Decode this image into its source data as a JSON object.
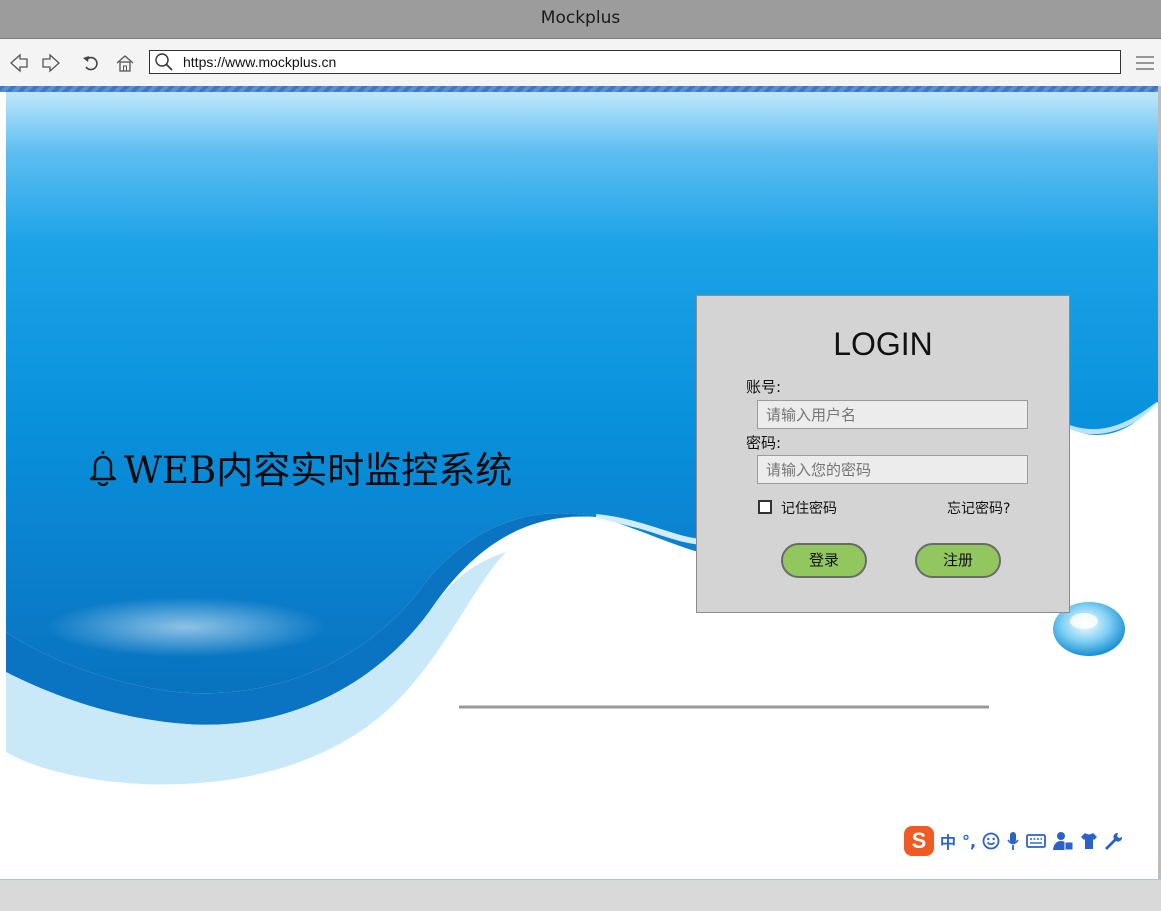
{
  "window": {
    "title": "Mockplus"
  },
  "browser": {
    "url": "https://www.mockplus.cn",
    "icons": [
      "back-icon",
      "forward-icon",
      "refresh-icon",
      "home-icon",
      "search-icon",
      "menu-icon"
    ]
  },
  "hero": {
    "heading": "WEB内容实时监控系统",
    "icon": "bell-icon"
  },
  "login": {
    "title": "LOGIN",
    "username_label": "账号:",
    "username_placeholder": "请输入用户名",
    "password_label": "密码:",
    "password_placeholder": "请输入您的密码",
    "remember_label": "记住密码",
    "remember_checked": false,
    "forgot_label": "忘记密码?",
    "login_button": "登录",
    "register_button": "注册"
  },
  "ime_toolbar": {
    "logo": "S",
    "mode": "中",
    "punct": "°,",
    "icons": [
      "emoji-icon",
      "microphone-icon",
      "keyboard-icon",
      "user-tools-icon",
      "skin-icon",
      "wrench-icon"
    ]
  },
  "colors": {
    "button_green": "#92c760",
    "panel_gray": "#d4d4d4",
    "sky_blue": "#0a8fdc"
  }
}
